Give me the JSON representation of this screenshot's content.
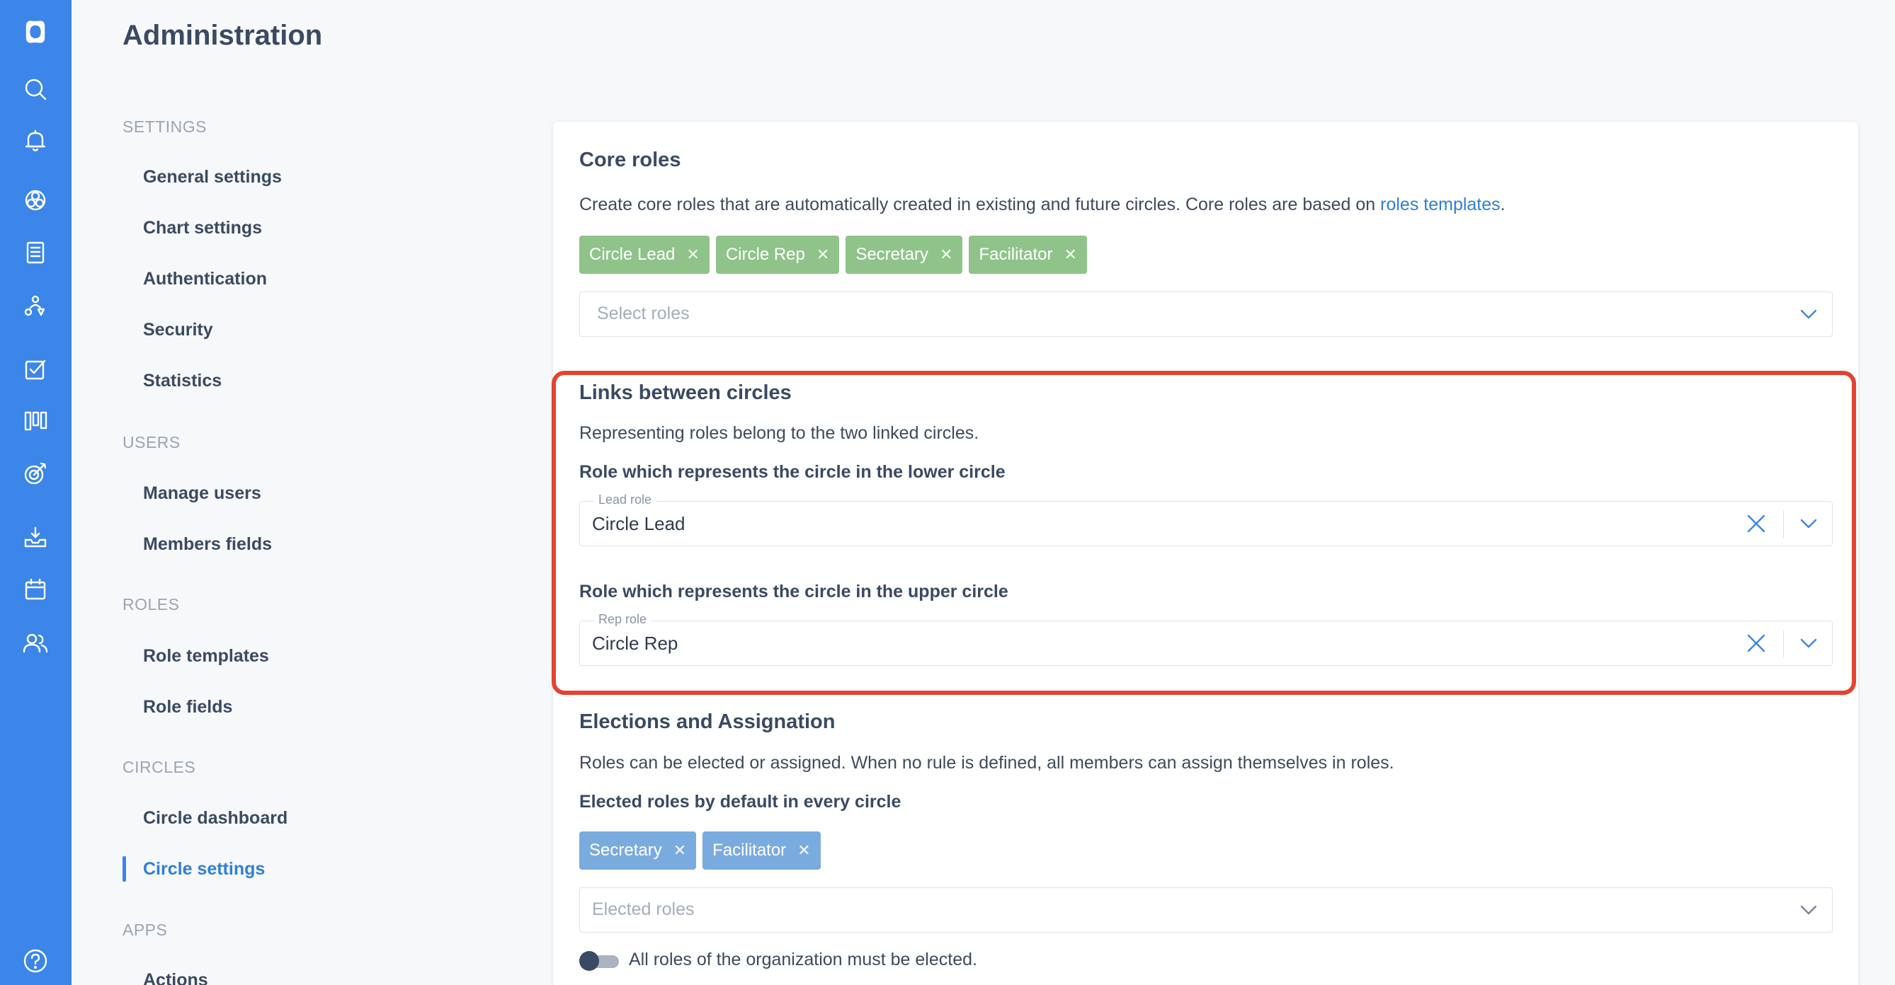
{
  "page_title": "Administration",
  "nav": {
    "sections": [
      {
        "label": "SETTINGS",
        "items": [
          "General settings",
          "Chart settings",
          "Authentication",
          "Security",
          "Statistics"
        ]
      },
      {
        "label": "USERS",
        "items": [
          "Manage users",
          "Members fields"
        ]
      },
      {
        "label": "ROLES",
        "items": [
          "Role templates",
          "Role fields"
        ]
      },
      {
        "label": "CIRCLES",
        "items": [
          "Circle dashboard",
          "Circle settings"
        ]
      },
      {
        "label": "APPS",
        "items": [
          "Actions"
        ]
      }
    ],
    "active_item": "Circle settings"
  },
  "rail_icons": [
    "app-logo-icon",
    "search-icon",
    "bell-icon",
    "globe-icon",
    "document-icon",
    "roles-icon",
    "checkbox-icon",
    "kanban-icon",
    "target-icon",
    "inbox-icon",
    "calendar-icon",
    "users-icon",
    "help-icon"
  ],
  "core_roles": {
    "title": "Core roles",
    "description_prefix": "Create core roles that are automatically created in existing and future circles. Core roles are based on ",
    "description_link": "roles templates",
    "description_suffix": ".",
    "chips": [
      "Circle Lead",
      "Circle Rep",
      "Secretary",
      "Facilitator"
    ],
    "select_placeholder": "Select roles"
  },
  "links": {
    "title": "Links between circles",
    "description": "Representing roles belong to the two linked circles.",
    "lower_label": "Role which represents the circle in the lower circle",
    "lower_field_label": "Lead role",
    "lower_value": "Circle Lead",
    "upper_label": "Role which represents the circle in the upper circle",
    "upper_field_label": "Rep role",
    "upper_value": "Circle Rep"
  },
  "elections": {
    "title": "Elections and Assignation",
    "description": "Roles can be elected or assigned. When no rule is defined, all members can assign themselves in roles.",
    "default_label": "Elected roles by default in every circle",
    "chips": [
      "Secretary",
      "Facilitator"
    ],
    "select_placeholder": "Elected roles",
    "toggle_label": "All roles of the organization must be elected.",
    "toggle_on": false
  },
  "colors": {
    "rail": "#3b86e8",
    "accent": "#2f7fd8",
    "chip_green": "#8fc38a",
    "chip_blue": "#7aabde",
    "highlight": "#e5432f"
  }
}
